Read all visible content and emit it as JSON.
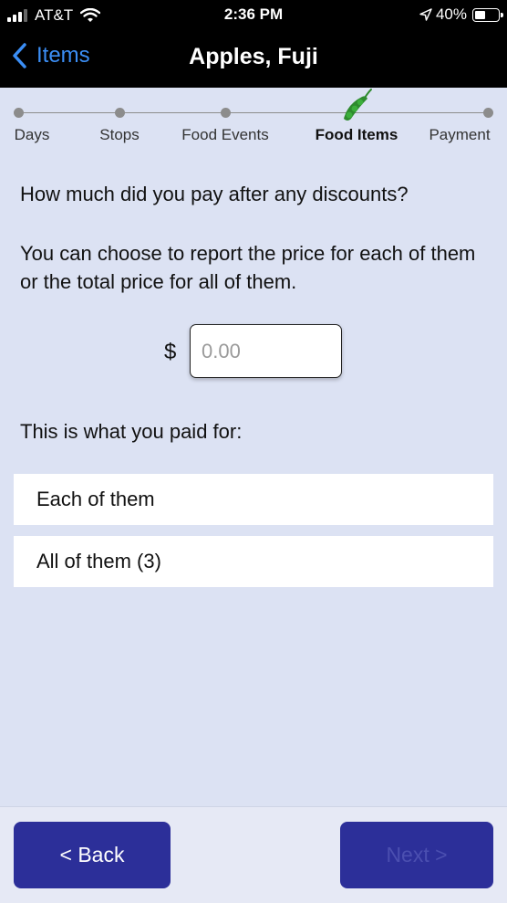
{
  "status_bar": {
    "carrier": "AT&T",
    "time": "2:36 PM",
    "battery": "40%",
    "battery_level": 0.4
  },
  "nav": {
    "back_label": "Items",
    "title": "Apples, Fuji"
  },
  "stepper": {
    "steps": [
      {
        "label": "Days"
      },
      {
        "label": "Stops"
      },
      {
        "label": "Food Events"
      },
      {
        "label": "Food Items"
      },
      {
        "label": "Payment"
      }
    ],
    "current_step": "Food Items"
  },
  "content": {
    "question": "How much did you pay after any discounts?",
    "explanation": "You can choose to report the price for each of them or the total price for all of them.",
    "currency_symbol": "$",
    "price_value": "",
    "price_placeholder": "0.00",
    "paid_for_label": "This is what you paid for:",
    "options": [
      {
        "label": "Each of them"
      },
      {
        "label": "All of them (3)"
      }
    ]
  },
  "footer": {
    "back_label": "< Back",
    "next_label": "Next >"
  },
  "colors": {
    "background": "#dce2f3",
    "accent_blue": "#3b8ef5",
    "button": "#2c2f99",
    "pea_green": "#2e8b2e"
  }
}
